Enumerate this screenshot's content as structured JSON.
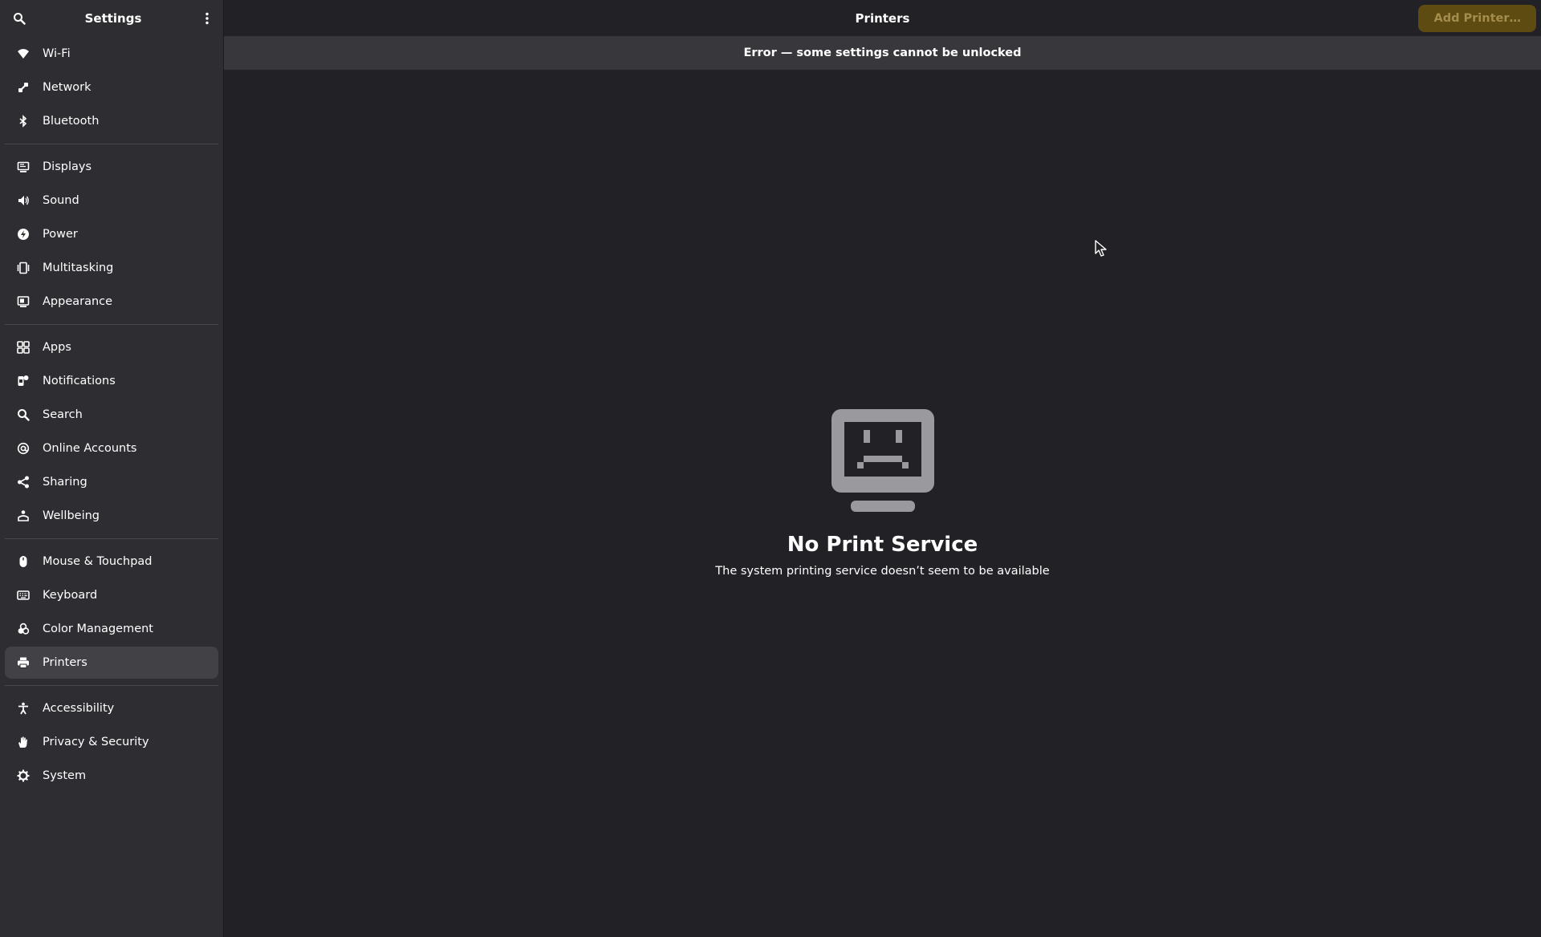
{
  "sidebar": {
    "title": "Settings",
    "groups": [
      [
        {
          "label": "Wi-Fi",
          "icon": "wifi-icon"
        },
        {
          "label": "Network",
          "icon": "network-icon"
        },
        {
          "label": "Bluetooth",
          "icon": "bluetooth-icon"
        }
      ],
      [
        {
          "label": "Displays",
          "icon": "display-icon"
        },
        {
          "label": "Sound",
          "icon": "speaker-icon"
        },
        {
          "label": "Power",
          "icon": "power-icon"
        },
        {
          "label": "Multitasking",
          "icon": "multitasking-icon"
        },
        {
          "label": "Appearance",
          "icon": "appearance-icon"
        }
      ],
      [
        {
          "label": "Apps",
          "icon": "apps-grid-icon"
        },
        {
          "label": "Notifications",
          "icon": "notifications-icon"
        },
        {
          "label": "Search",
          "icon": "search-icon"
        },
        {
          "label": "Online Accounts",
          "icon": "at-sign-icon"
        },
        {
          "label": "Sharing",
          "icon": "share-icon"
        },
        {
          "label": "Wellbeing",
          "icon": "wellbeing-icon"
        }
      ],
      [
        {
          "label": "Mouse & Touchpad",
          "icon": "mouse-icon"
        },
        {
          "label": "Keyboard",
          "icon": "keyboard-icon"
        },
        {
          "label": "Color Management",
          "icon": "color-icon"
        },
        {
          "label": "Printers",
          "icon": "printer-icon",
          "active": true
        }
      ],
      [
        {
          "label": "Accessibility",
          "icon": "accessibility-icon"
        },
        {
          "label": "Privacy & Security",
          "icon": "hand-icon"
        },
        {
          "label": "System",
          "icon": "gear-icon"
        }
      ]
    ]
  },
  "header": {
    "title": "Printers",
    "add_button": "Add Printer…"
  },
  "banner": {
    "text": "Error — some settings cannot be unlocked"
  },
  "status": {
    "icon": "sad-computer-icon",
    "title": "No Print Service",
    "description": "The system printing service doesn’t seem to be available"
  },
  "colors": {
    "sidebar_bg": "#2e2e32",
    "main_bg": "#222226",
    "banner_bg": "#38383c",
    "accent_button_bg": "#5d4b12",
    "accent_button_fg": "#a48c4b"
  }
}
